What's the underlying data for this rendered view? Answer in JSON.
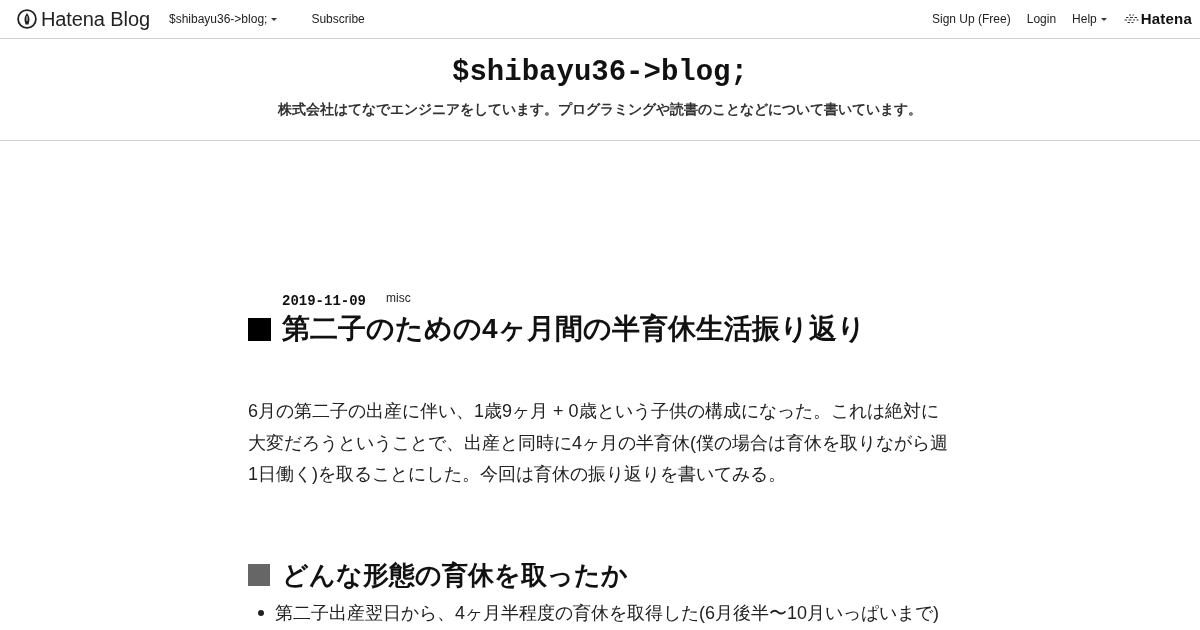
{
  "navbar": {
    "brand": "Hatena Blog",
    "left_items": [
      {
        "label": "$shibayu36->blog;",
        "kind": "dropdown"
      },
      {
        "label": "Subscribe",
        "kind": "link"
      }
    ],
    "right_items": [
      {
        "label": "Sign Up (Free)",
        "kind": "link"
      },
      {
        "label": "Login",
        "kind": "link"
      },
      {
        "label": "Help",
        "kind": "dropdown"
      }
    ],
    "company_logo": "Hatena"
  },
  "blog_header": {
    "title": "$shibayu36->blog;",
    "description": "株式会社はてなでエンジニアをしています。プログラミングや読書のことなどについて書いています。"
  },
  "article": {
    "date": "2019-11-09",
    "categories": [
      "misc"
    ],
    "title": "第二子のための4ヶ月間の半育休生活振り返り",
    "intro": "6月の第二子の出産に伴い、1歳9ヶ月 + 0歳という子供の構成になった。これは絶対に大変だろうということで、出産と同時に4ヶ月の半育休(僕の場合は育休を取りながら週1日働く)を取ることにした。今回は育休の振り返りを書いてみる。",
    "sections": [
      {
        "heading": "どんな形態の育休を取ったか",
        "bullets": [
          "第二子出産翌日から、4ヶ月半程度の育休を取得した(6月後半〜10月いっぱいまで)"
        ]
      }
    ]
  }
}
